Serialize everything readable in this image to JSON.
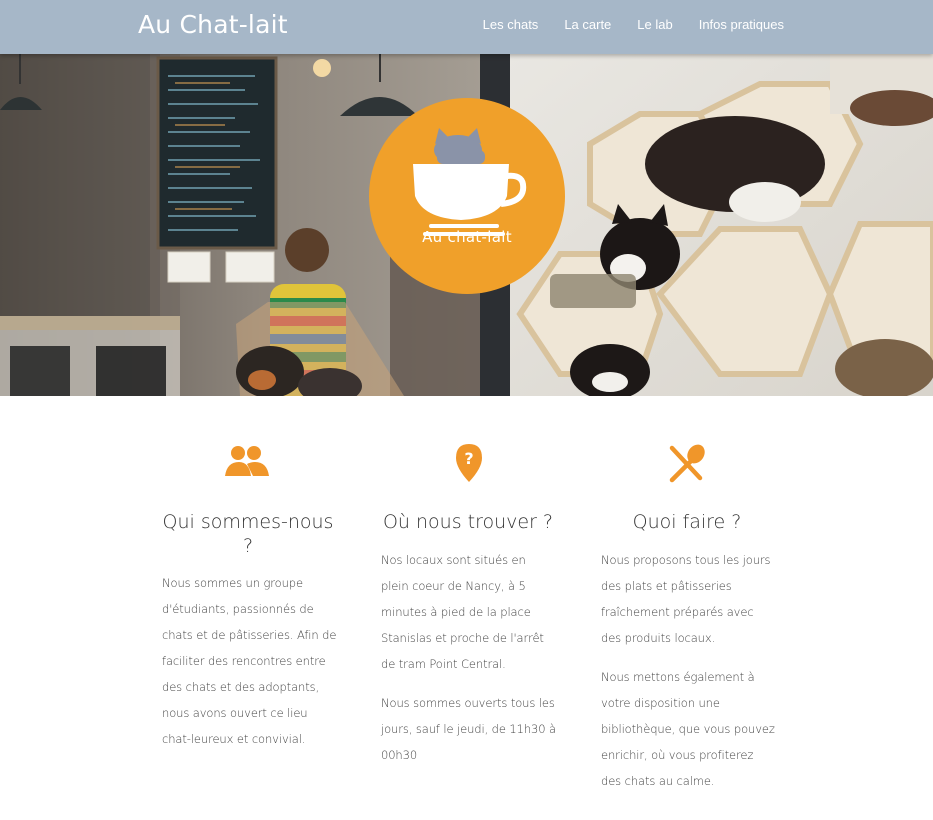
{
  "navbar": {
    "brand": "Au Chat-lait",
    "links": [
      "Les chats",
      "La carte",
      "Le lab",
      "Infos pratiques"
    ]
  },
  "hero": {
    "logo_text": "Au chat-lait",
    "logo_color": "#f0a02a"
  },
  "features": [
    {
      "icon": "users-icon",
      "title": "Qui sommes-nous ?",
      "paragraphs": [
        "Nous sommes un groupe d'étudiants, passionnés de chats et de pâtisseries. Afin de faciliter des rencontres entre des chats et des adoptants, nous avons ouvert ce lieu chat-leureux et convivial."
      ]
    },
    {
      "icon": "map-pin-question-icon",
      "title": "Où nous trouver ?",
      "paragraphs": [
        "Nos locaux sont situés en plein coeur de Nancy, à 5 minutes à pied de la place Stanislas et proche de l'arrêt de tram Point Central.",
        "Nous sommes ouverts tous les jours, sauf le jeudi, de 11h30 à 00h30"
      ]
    },
    {
      "icon": "utensils-icon",
      "title": "Quoi faire ?",
      "paragraphs": [
        "Nous proposons tous les jours des plats et pâtisseries fraîchement préparés avec des produits locaux.",
        "Nous mettons également à votre disposition une bibliothèque, que vous pouvez enrichir, où vous profiterez des chats au calme."
      ]
    }
  ],
  "colors": {
    "accent": "#f0962a",
    "navbar": "#a6b7c8"
  }
}
